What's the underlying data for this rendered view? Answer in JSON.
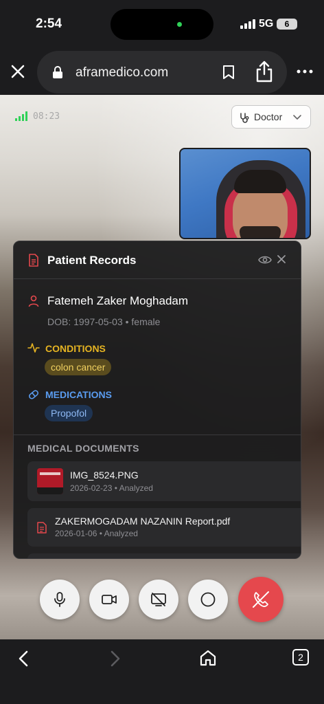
{
  "status_bar": {
    "time": "2:54",
    "network": "5G",
    "battery": "6"
  },
  "browser": {
    "url": "aframedico.com",
    "tab_count": "2"
  },
  "call": {
    "timer": "08:23",
    "role": "Doctor"
  },
  "panel": {
    "title": "Patient Records",
    "patient": {
      "name": "Fatemeh Zaker Moghadam",
      "dob_line": "DOB: 1997-05-03 • female"
    },
    "conditions": {
      "label": "CONDITIONS",
      "items": [
        "colon cancer"
      ]
    },
    "medications": {
      "label": "MEDICATIONS",
      "items": [
        "Propofol"
      ]
    },
    "documents": {
      "label": "MEDICAL DOCUMENTS",
      "items": [
        {
          "name": "IMG_8524.PNG",
          "meta": "2026-02-23 • Analyzed"
        },
        {
          "name": "ZAKERMOGADAM NAZANIN Report.pdf",
          "meta": "2026-01-06 • Analyzed"
        }
      ]
    }
  },
  "colors": {
    "conditions": "#e6b422",
    "medications": "#5a9cf0",
    "hangup": "#e5484d",
    "accent_red": "#e5484d"
  },
  "icons": [
    "close-icon",
    "lock-icon",
    "bookmark-icon",
    "share-icon",
    "more-icon",
    "stethoscope-icon",
    "chevron-down-icon",
    "document-icon",
    "eye-icon",
    "person-icon",
    "pulse-icon",
    "pill-icon",
    "pdf-icon",
    "microphone-icon",
    "video-icon",
    "screen-share-off-icon",
    "record-icon",
    "hang-up-icon",
    "back-icon",
    "forward-icon",
    "home-icon"
  ]
}
